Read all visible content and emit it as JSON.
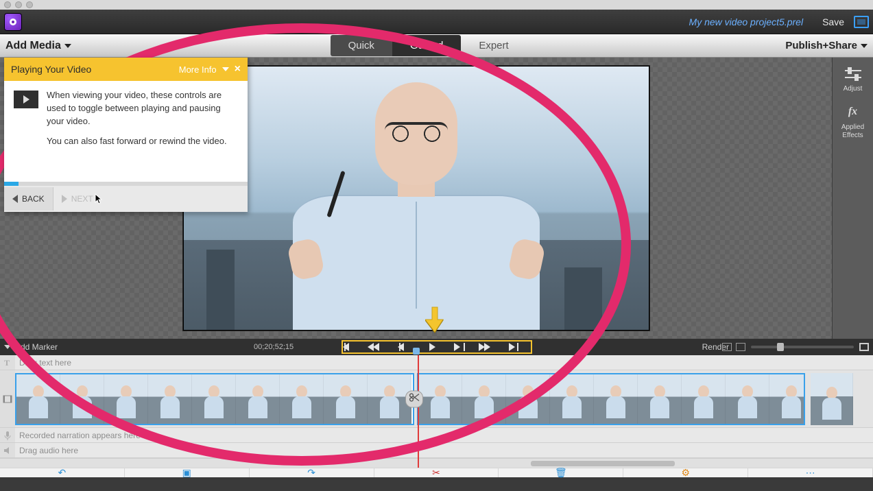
{
  "project_filename": "My new video project5.prel",
  "save_label": "Save",
  "toolbar": {
    "add_media": "Add Media",
    "publish_share": "Publish+Share"
  },
  "modes": {
    "quick": "Quick",
    "guided": "Guided",
    "expert": "Expert"
  },
  "right_panel": {
    "adjust": "Adjust",
    "applied_effects": "Applied\nEffects"
  },
  "transport": {
    "add_marker": "Add Marker",
    "timecode": "00;20;52;15",
    "render": "Render"
  },
  "tip": {
    "title": "Playing Your Video",
    "more_info": "More Info",
    "body1": "When viewing your video, these controls are used to toggle between playing and pausing your video.",
    "body2": "You can also fast forward or rewind the video.",
    "back": "BACK",
    "next": "NEXT"
  },
  "timeline": {
    "text_track_placeholder": "Drag text here",
    "narration_placeholder": "Recorded narration appears here",
    "audio_placeholder": "Drag audio here"
  }
}
